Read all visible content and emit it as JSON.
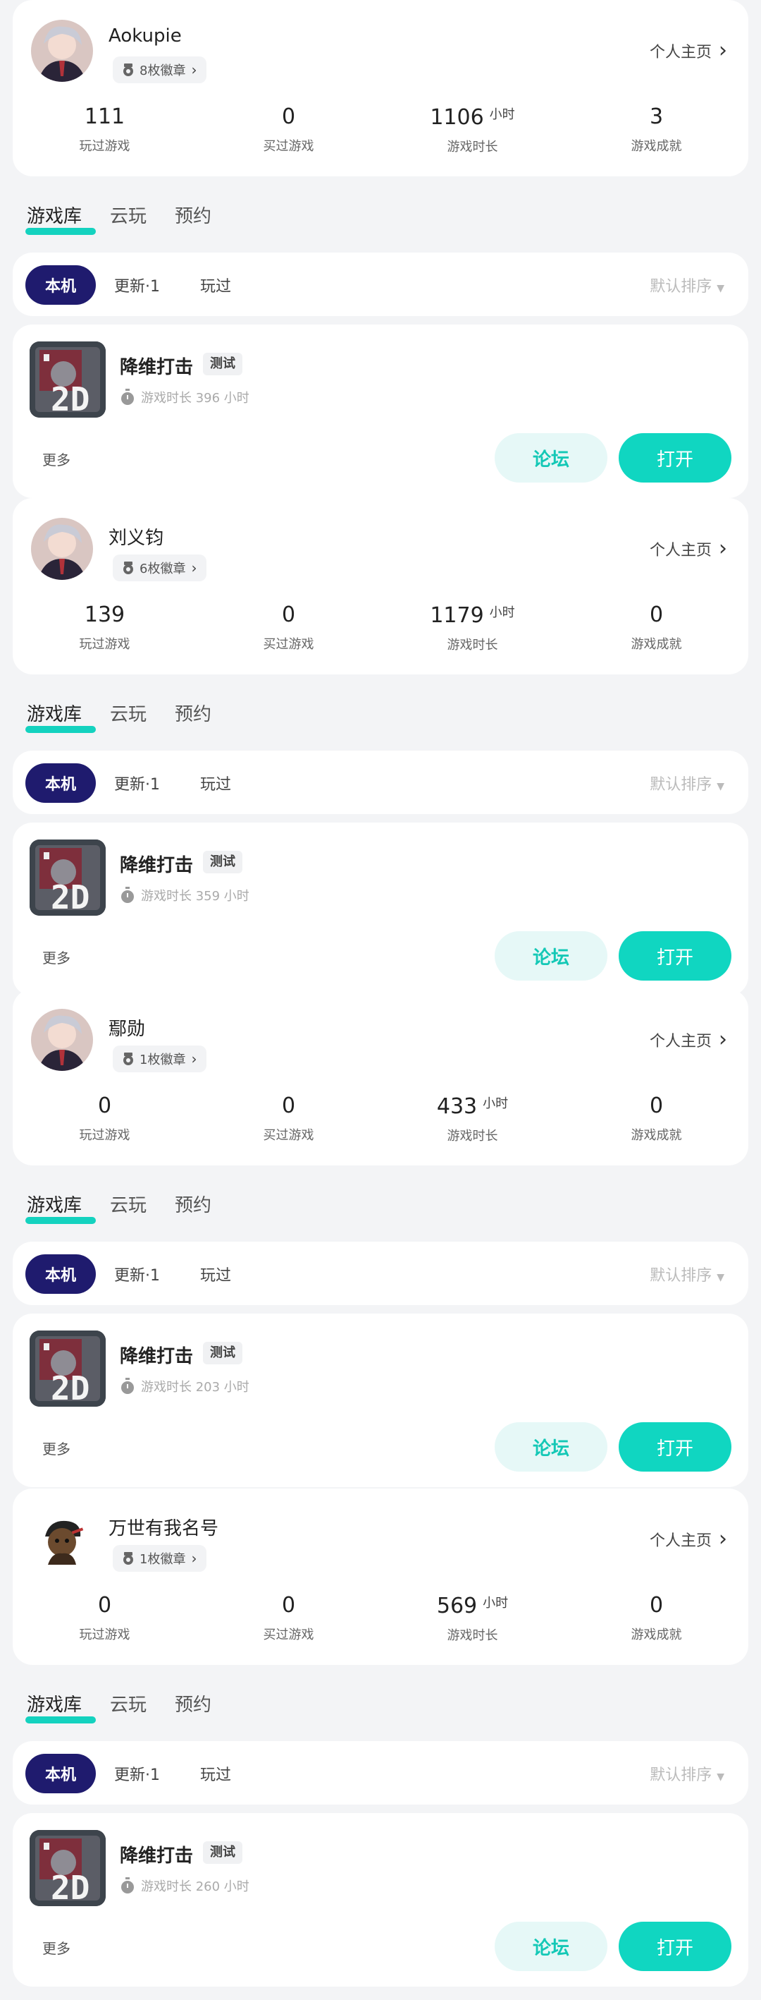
{
  "colors": {
    "accent": "#14d2bf",
    "chip_active_bg": "#1f1b6e",
    "forum_bg": "#e6f8f7",
    "open_bg": "#10d6c1"
  },
  "icons": {
    "badge": "medal-icon",
    "timer": "stopwatch-icon",
    "chevron": "chevron-right-icon",
    "sort": "caret-down-icon"
  },
  "sections": [
    {
      "profile": {
        "name": "Aokupie",
        "badges": "8枚徽章",
        "homepage": "个人主页",
        "stats": [
          {
            "value": "111",
            "unit": "",
            "label": "玩过游戏"
          },
          {
            "value": "0",
            "unit": "",
            "label": "买过游戏"
          },
          {
            "value": "1106",
            "unit": "小时",
            "label": "游戏时长"
          },
          {
            "value": "3",
            "unit": "",
            "label": "游戏成就"
          }
        ]
      },
      "tabs": [
        "游戏库",
        "云玩",
        "预约"
      ],
      "filters": {
        "local": "本机",
        "update": "更新·1",
        "played": "玩过",
        "sort": "默认排序"
      },
      "game": {
        "title": "降维打击",
        "tag": "测试",
        "playtime": "游戏时长 396 小时",
        "more": "更多",
        "forum": "论坛",
        "open": "打开"
      }
    },
    {
      "profile": {
        "name": "刘义钧",
        "badges": "6枚徽章",
        "homepage": "个人主页",
        "stats": [
          {
            "value": "139",
            "unit": "",
            "label": "玩过游戏"
          },
          {
            "value": "0",
            "unit": "",
            "label": "买过游戏"
          },
          {
            "value": "1179",
            "unit": "小时",
            "label": "游戏时长"
          },
          {
            "value": "0",
            "unit": "",
            "label": "游戏成就"
          }
        ]
      },
      "tabs": [
        "游戏库",
        "云玩",
        "预约"
      ],
      "filters": {
        "local": "本机",
        "update": "更新·1",
        "played": "玩过",
        "sort": "默认排序"
      },
      "game": {
        "title": "降维打击",
        "tag": "测试",
        "playtime": "游戏时长 359 小时",
        "more": "更多",
        "forum": "论坛",
        "open": "打开"
      }
    },
    {
      "profile": {
        "name": "鄢勋",
        "badges": "1枚徽章",
        "homepage": "个人主页",
        "stats": [
          {
            "value": "0",
            "unit": "",
            "label": "玩过游戏"
          },
          {
            "value": "0",
            "unit": "",
            "label": "买过游戏"
          },
          {
            "value": "433",
            "unit": "小时",
            "label": "游戏时长"
          },
          {
            "value": "0",
            "unit": "",
            "label": "游戏成就"
          }
        ]
      },
      "tabs": [
        "游戏库",
        "云玩",
        "预约"
      ],
      "filters": {
        "local": "本机",
        "update": "更新·1",
        "played": "玩过",
        "sort": "默认排序"
      },
      "game": {
        "title": "降维打击",
        "tag": "测试",
        "playtime": "游戏时长 203 小时",
        "more": "更多",
        "forum": "论坛",
        "open": "打开"
      }
    },
    {
      "profile": {
        "name": "万世有我名号",
        "badges": "1枚徽章",
        "homepage": "个人主页",
        "stats": [
          {
            "value": "0",
            "unit": "",
            "label": "玩过游戏"
          },
          {
            "value": "0",
            "unit": "",
            "label": "买过游戏"
          },
          {
            "value": "569",
            "unit": "小时",
            "label": "游戏时长"
          },
          {
            "value": "0",
            "unit": "",
            "label": "游戏成就"
          }
        ]
      },
      "tabs": [
        "游戏库",
        "云玩",
        "预约"
      ],
      "filters": {
        "local": "本机",
        "update": "更新·1",
        "played": "玩过",
        "sort": "默认排序"
      },
      "game": {
        "title": "降维打击",
        "tag": "测试",
        "playtime": "游戏时长 260 小时",
        "more": "更多",
        "forum": "论坛",
        "open": "打开"
      }
    }
  ]
}
